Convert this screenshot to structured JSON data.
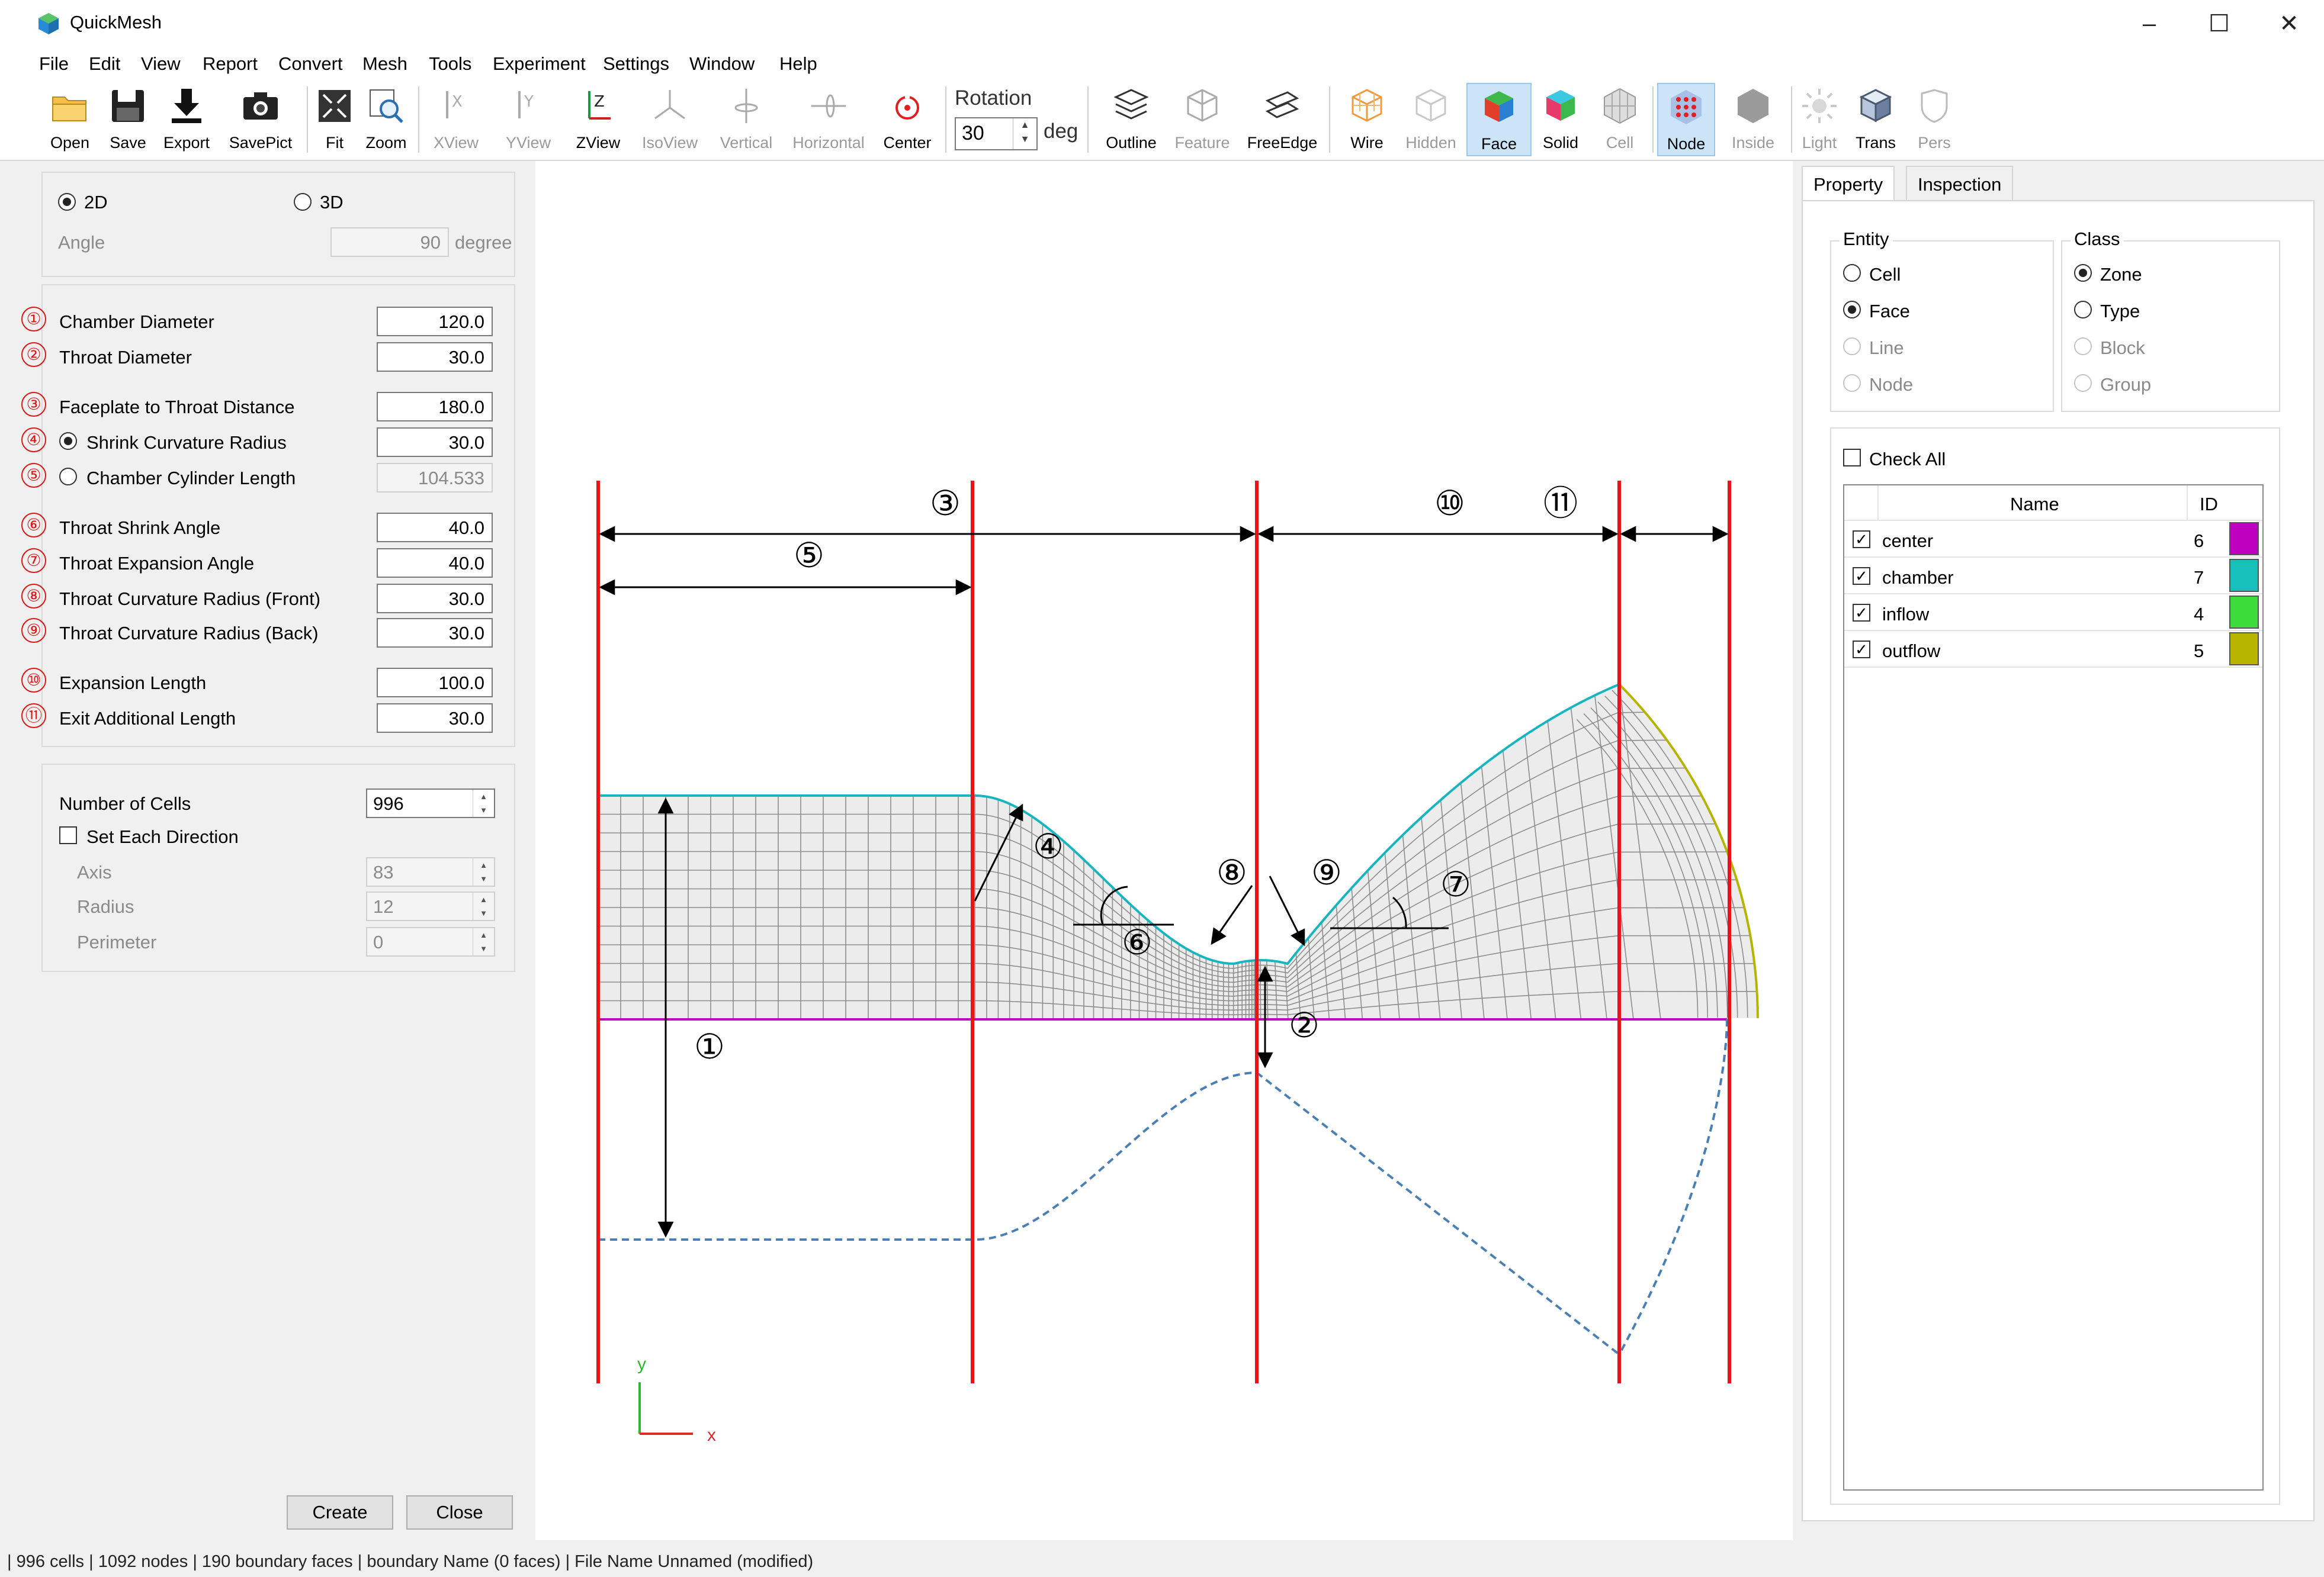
{
  "window": {
    "title": "QuickMesh",
    "minimize": "–",
    "maximize": "☐",
    "close": "✕"
  },
  "menu": [
    "File",
    "Edit",
    "View",
    "Report",
    "Convert",
    "Mesh",
    "Tools",
    "Experiment",
    "Settings",
    "Window",
    "Help"
  ],
  "toolbar": {
    "open": "Open",
    "save": "Save",
    "export": "Export",
    "savepict": "SavePict",
    "fit": "Fit",
    "zoom": "Zoom",
    "xview": "XView",
    "yview": "YView",
    "zview": "ZView",
    "isoview": "IsoView",
    "vertical": "Vertical",
    "horizontal": "Horizontal",
    "center": "Center",
    "rotation_label": "Rotation",
    "rotation_value": "30",
    "rotation_unit": "deg",
    "outline": "Outline",
    "feature": "Feature",
    "freeedge": "FreeEdge",
    "wire": "Wire",
    "hidden": "Hidden",
    "face": "Face",
    "solid": "Solid",
    "cell": "Cell",
    "node": "Node",
    "inside": "Inside",
    "light": "Light",
    "trans": "Trans",
    "pers": "Pers"
  },
  "dimension": {
    "option_2d": "2D",
    "option_3d": "3D",
    "selected": "2D",
    "angle_label": "Angle",
    "angle_value": "90",
    "angle_unit": "degree"
  },
  "params": [
    {
      "num": "①",
      "label": "Chamber Diameter",
      "value": "120.0"
    },
    {
      "num": "②",
      "label": "Throat Diameter",
      "value": "30.0"
    },
    {
      "num": "③",
      "label": "Faceplate to Throat Distance",
      "value": "180.0"
    },
    {
      "num": "④",
      "label": "Shrink Curvature Radius",
      "value": "30.0"
    },
    {
      "num": "⑤",
      "label": "Chamber Cylinder Length",
      "value": "104.533"
    },
    {
      "num": "⑥",
      "label": "Throat Shrink Angle",
      "value": "40.0"
    },
    {
      "num": "⑦",
      "label": "Throat Expansion Angle",
      "value": "40.0"
    },
    {
      "num": "⑧",
      "label": "Throat Curvature Radius (Front)",
      "value": "30.0"
    },
    {
      "num": "⑨",
      "label": "Throat Curvature Radius (Back)",
      "value": "30.0"
    },
    {
      "num": "⑩",
      "label": "Expansion Length",
      "value": "100.0"
    },
    {
      "num": "⑪",
      "label": "Exit Additional Length",
      "value": "30.0"
    }
  ],
  "cells": {
    "count_label": "Number of Cells",
    "count_value": "996",
    "set_each_label": "Set Each Direction",
    "set_each_checked": false,
    "axis_label": "Axis",
    "axis_value": "83",
    "radius_label": "Radius",
    "radius_value": "12",
    "perimeter_label": "Perimeter",
    "perimeter_value": "0"
  },
  "buttons": {
    "create": "Create",
    "close": "Close"
  },
  "viewport": {
    "dimension_marks": [
      "③",
      "⑤",
      "⑩",
      "⑪",
      "④",
      "⑧",
      "⑨",
      "⑥",
      "⑦",
      "①",
      "②"
    ],
    "axis_y": "y",
    "axis_x": "x",
    "colors": {
      "guide": "#e8141a",
      "center": "#c000c0",
      "chamber": "#16b5c0",
      "outflow": "#b5b400",
      "mesh": "#8d8d8d",
      "mirror": "#4a7fb5"
    }
  },
  "right": {
    "tab_property": "Property",
    "tab_inspection": "Inspection",
    "entity_legend": "Entity",
    "entity_options": [
      {
        "label": "Cell",
        "state": "off"
      },
      {
        "label": "Face",
        "state": "on"
      },
      {
        "label": "Line",
        "state": "disabled"
      },
      {
        "label": "Node",
        "state": "disabled"
      }
    ],
    "class_legend": "Class",
    "class_options": [
      {
        "label": "Zone",
        "state": "on"
      },
      {
        "label": "Type",
        "state": "off"
      },
      {
        "label": "Block",
        "state": "disabled"
      },
      {
        "label": "Group",
        "state": "disabled"
      }
    ],
    "check_all": "Check All",
    "col_name": "Name",
    "col_id": "ID",
    "zones": [
      {
        "name": "center",
        "id": "6",
        "color": "#c000c0",
        "checked": true
      },
      {
        "name": "chamber",
        "id": "7",
        "color": "#18c0bc",
        "checked": true
      },
      {
        "name": "inflow",
        "id": "4",
        "color": "#3cdc3c",
        "checked": true
      },
      {
        "name": "outflow",
        "id": "5",
        "color": "#b8b400",
        "checked": true
      }
    ]
  },
  "status": "| 996 cells | 1092 nodes | 190 boundary faces |  boundary Name  (0 faces) | File Name Unnamed (modified)"
}
